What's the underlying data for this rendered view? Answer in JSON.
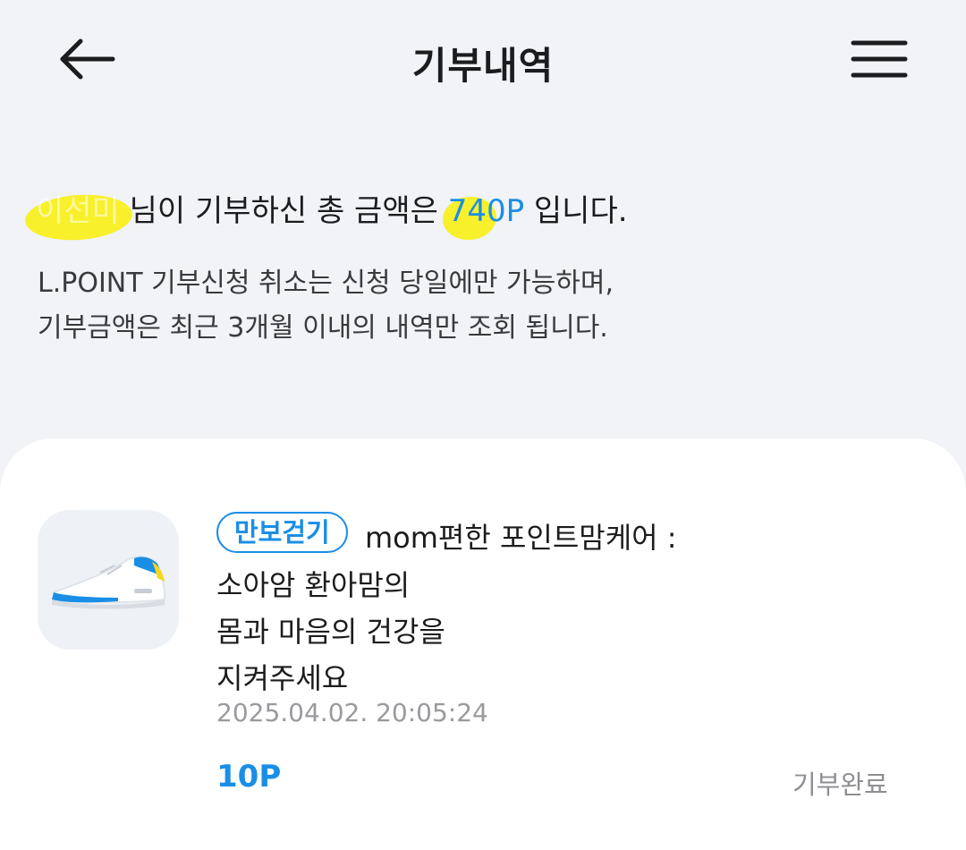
{
  "header": {
    "title": "기부내역",
    "back_icon": "arrow-left-icon",
    "menu_icon": "hamburger-menu-icon"
  },
  "summary": {
    "user_name": "이선미",
    "text_middle": "님이 기부하신 총 금액은 ",
    "total_amount": "740P",
    "text_end": "입니다."
  },
  "notice": {
    "line1": "L.POINT 기부신청 취소는 신청 당일에만 가능하며,",
    "line2": "기부금액은 최근 3개월 이내의 내역만 조회 됩니다."
  },
  "donations": [
    {
      "tag": "만보걷기",
      "campaign_line1": "mom편한 포인트맘케어 :",
      "campaign_line2": "소아암 환아맘의",
      "campaign_line3": "몸과 마음의 건강을",
      "campaign_line4": "지켜주세요",
      "date": "2025.04.02. 20:05:24",
      "points": "10P",
      "status": "기부완료",
      "thumbnail_icon": "sneaker-icon"
    }
  ],
  "colors": {
    "accent": "#1a8ee6",
    "background": "#f1f3f6",
    "card": "#ffffff",
    "highlight": "#f8ef20"
  }
}
